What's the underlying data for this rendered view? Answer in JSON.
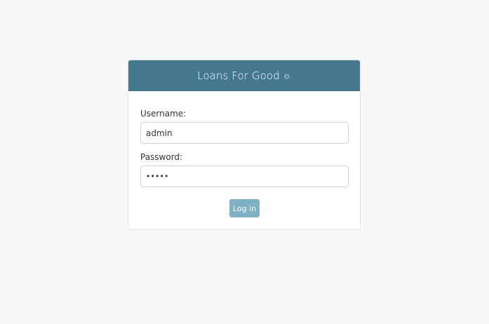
{
  "header": {
    "title": "Loans For Good",
    "icon": "sun-icon"
  },
  "form": {
    "username_label": "Username:",
    "username_value": "admin",
    "password_label": "Password:",
    "password_value": "•••••",
    "login_label": "Log in"
  },
  "colors": {
    "header_bg": "#43788f",
    "button_bg": "#7fb0c6",
    "page_bg": "#f7f7f7"
  }
}
